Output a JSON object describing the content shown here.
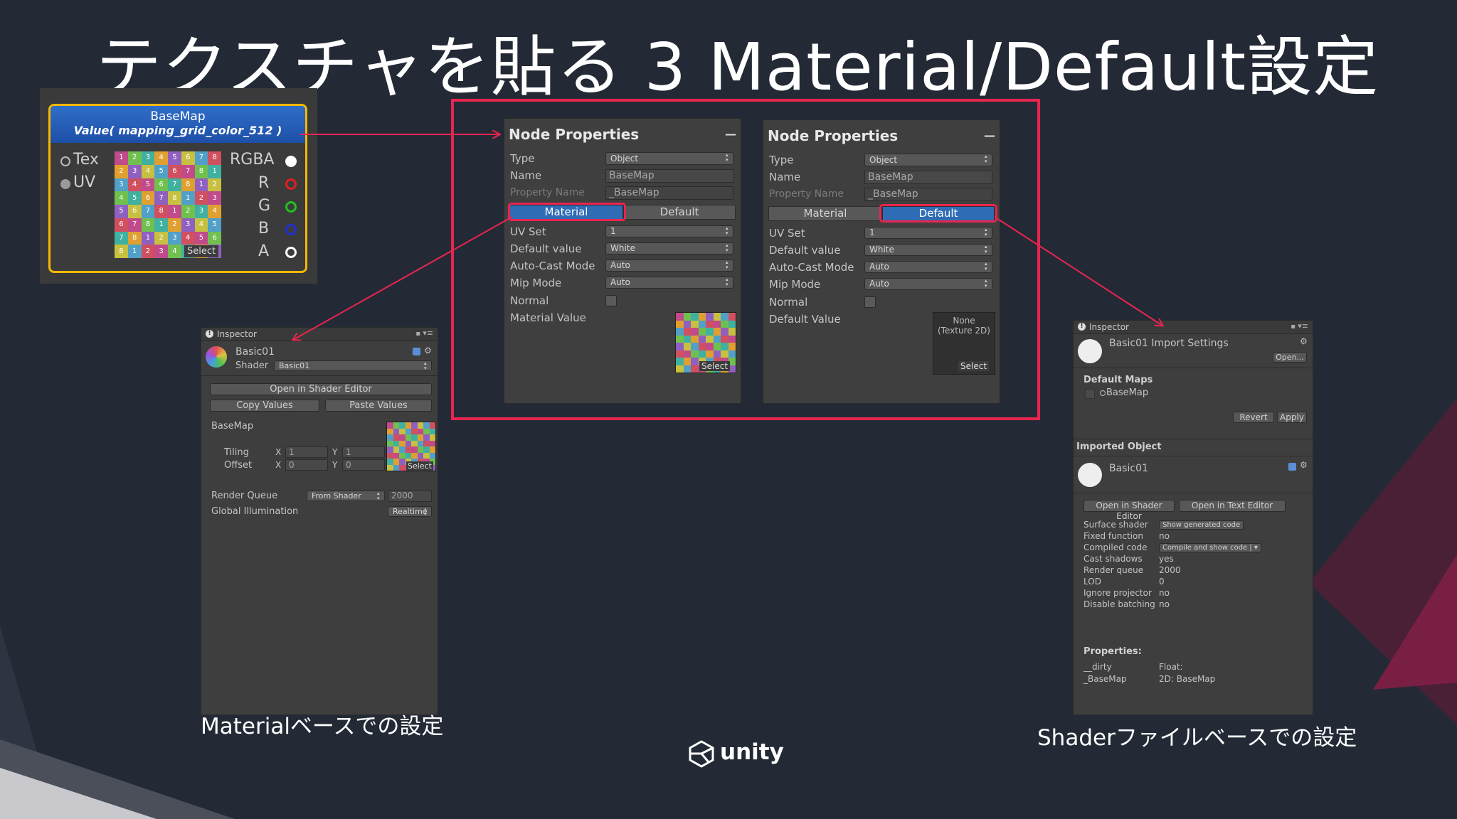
{
  "title": "テクスチャを貼る 3 Material/Default設定",
  "node": {
    "name": "BaseMap",
    "value": "Value( mapping_grid_color_512 )",
    "inputs": [
      "Tex",
      "UV"
    ],
    "outputs": [
      "RGBA",
      "R",
      "G",
      "B",
      "A"
    ],
    "select": "Select",
    "grid_digits": [
      "1",
      "2",
      "3",
      "4",
      "5",
      "6",
      "7",
      "8",
      "2",
      "3",
      "4",
      "5",
      "6",
      "7",
      "8",
      "1",
      "3",
      "4",
      "5",
      "6",
      "7",
      "8",
      "1",
      "2",
      "4",
      "5",
      "6",
      "7",
      "8",
      "1",
      "2",
      "3",
      "5",
      "6",
      "7",
      "8",
      "1",
      "2",
      "3",
      "4",
      "6",
      "7",
      "8",
      "1",
      "2",
      "3",
      "4",
      "5",
      "7",
      "8",
      "1",
      "2",
      "3",
      "4",
      "5",
      "6",
      "8",
      "1",
      "2",
      "3",
      "4",
      "5",
      "6",
      "7"
    ]
  },
  "np_left": {
    "title": "Node Properties",
    "collapse": "—",
    "type_label": "Type",
    "type_value": "Object",
    "name_label": "Name",
    "name_value": "BaseMap",
    "prop_label": "Property Name",
    "prop_value": "_BaseMap",
    "tab_material": "Material",
    "tab_default": "Default",
    "uvset_label": "UV Set",
    "uvset_value": "1",
    "defval_label": "Default value",
    "defval_value": "White",
    "autocast_label": "Auto-Cast Mode",
    "autocast_value": "Auto",
    "mip_label": "Mip Mode",
    "mip_value": "Auto",
    "normal_label": "Normal",
    "value_label": "Material Value",
    "select": "Select"
  },
  "np_right": {
    "title": "Node Properties",
    "collapse": "—",
    "type_label": "Type",
    "type_value": "Object",
    "name_label": "Name",
    "name_value": "BaseMap",
    "prop_label": "Property Name",
    "prop_value": "_BaseMap",
    "tab_material": "Material",
    "tab_default": "Default",
    "uvset_label": "UV Set",
    "uvset_value": "1",
    "defval_label": "Default value",
    "defval_value": "White",
    "autocast_label": "Auto-Cast Mode",
    "autocast_value": "Auto",
    "mip_label": "Mip Mode",
    "mip_value": "Auto",
    "normal_label": "Normal",
    "value_label": "Default Value",
    "none_text": "None (Texture 2D)",
    "select": "Select"
  },
  "inspector_left": {
    "tab": "Inspector",
    "asset_name": "Basic01",
    "shader_label": "Shader",
    "shader_value": "Basic01",
    "open_shader_editor": "Open in Shader Editor",
    "copy_values": "Copy Values",
    "paste_values": "Paste Values",
    "basemap": "BaseMap",
    "tiling": "Tiling",
    "offset": "Offset",
    "tiling_x": "1",
    "tiling_y": "1",
    "offset_x": "0",
    "offset_y": "0",
    "x_lbl": "X",
    "y_lbl": "Y",
    "select": "Select",
    "render_queue_label": "Render Queue",
    "render_queue_mode": "From Shader",
    "render_queue_value": "2000",
    "gi_label": "Global Illumination",
    "gi_value": "Realtime"
  },
  "inspector_right": {
    "tab": "Inspector",
    "title": "Basic01 Import Settings",
    "open": "Open...",
    "default_maps": "Default Maps",
    "basemap": "BaseMap",
    "revert": "Revert",
    "apply": "Apply",
    "imported_object": "Imported Object",
    "object_name": "Basic01",
    "open_shader_editor": "Open in Shader Editor",
    "open_text_editor": "Open in Text Editor",
    "rows": [
      {
        "label": "Surface shader",
        "value": "Show generated code",
        "button": true
      },
      {
        "label": "Fixed function",
        "value": "no",
        "button": false
      },
      {
        "label": "Compiled code",
        "value": "Compile and show code | ▾",
        "button": true
      },
      {
        "label": "Cast shadows",
        "value": "yes",
        "button": false
      },
      {
        "label": "Render queue",
        "value": "2000",
        "button": false
      },
      {
        "label": "LOD",
        "value": "0",
        "button": false
      },
      {
        "label": "Ignore projector",
        "value": "no",
        "button": false
      },
      {
        "label": "Disable batching",
        "value": "no",
        "button": false
      }
    ],
    "properties_label": "Properties:",
    "props": [
      {
        "label": "__dirty",
        "value": "Float:"
      },
      {
        "label": "_BaseMap",
        "value": "2D: BaseMap"
      }
    ]
  },
  "caption_left": "Materialベースでの設定",
  "caption_right": "Shaderファイルベースでの設定",
  "logo": "unity",
  "colors": {
    "highlight": "#e8254f",
    "node_border": "#f5b800",
    "node_header": "#2f6ec8",
    "background": "#232a36"
  }
}
